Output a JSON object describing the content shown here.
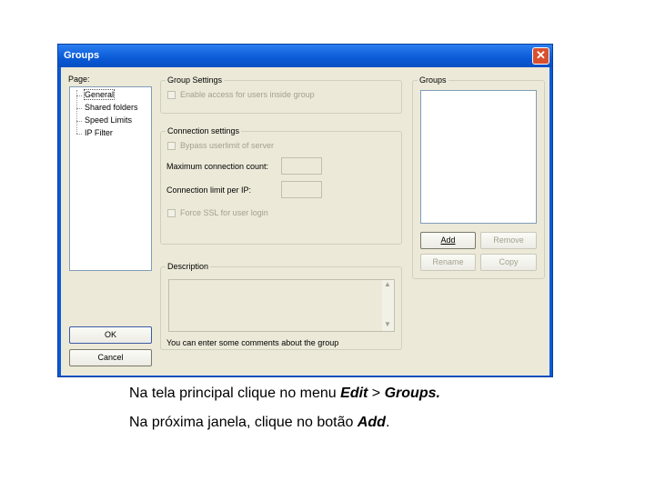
{
  "window": {
    "title": "Groups",
    "close_symbol": "✕"
  },
  "page_panel": {
    "label": "Page:",
    "items": [
      "General",
      "Shared folders",
      "Speed Limits",
      "IP Filter"
    ]
  },
  "group_settings": {
    "title": "Group Settings",
    "enable_access": "Enable access for users inside group"
  },
  "connection_settings": {
    "title": "Connection settings",
    "bypass": "Bypass userlimit of server",
    "max_conn_label": "Maximum connection count:",
    "max_conn_value": "",
    "per_ip_label": "Connection limit per IP:",
    "per_ip_value": "",
    "force_ssl": "Force SSL for user login"
  },
  "description": {
    "title": "Description",
    "value": "",
    "hint": "You can enter some comments about the group"
  },
  "groups_panel": {
    "title": "Groups",
    "add": "Add",
    "remove": "Remove",
    "rename": "Rename",
    "copy": "Copy"
  },
  "buttons": {
    "ok": "OK",
    "cancel": "Cancel"
  },
  "caption": {
    "line1_prefix": "Na tela principal clique no menu ",
    "line1_edit": "Edit",
    "line1_sep": " > ",
    "line1_groups": "Groups.",
    "line2_prefix": "Na  próxima  janela,  clique  no botão ",
    "line2_add": "Add",
    "line2_suffix": "."
  }
}
